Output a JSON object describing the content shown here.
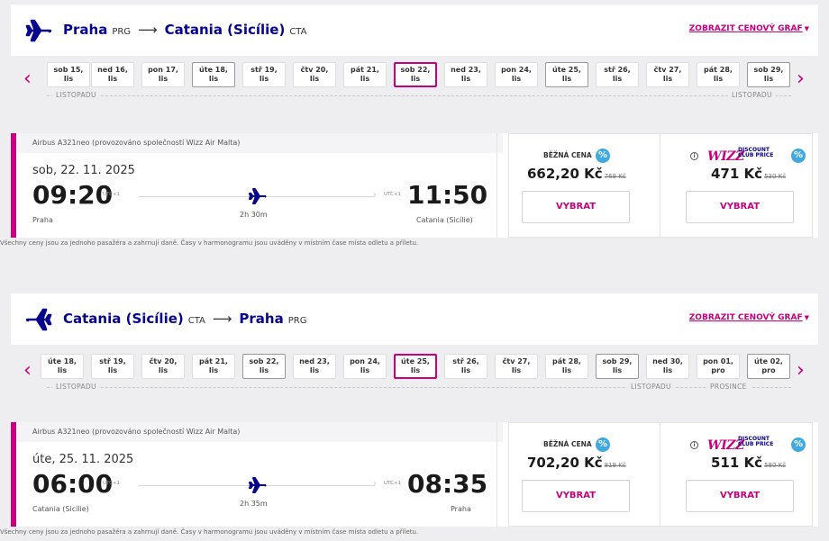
{
  "colors": {
    "brand": "#06038d",
    "accent": "#c6007e",
    "badge": "#3fa9e0"
  },
  "footnote": "Všechny ceny jsou za jednoho pasažéra a zahrnují daně. Časy v harmonogramu jsou uváděny v místním čase místa odletu a příletu.",
  "outbound": {
    "from_city": "Praha",
    "from_code": "PRG",
    "to_city": "Catania (Sicílie)",
    "to_code": "CTA",
    "arrow": "⟶",
    "chart_link": "ZOBRAZIT CENOVÝ GRAF",
    "month_left": "LISTOPADU",
    "month_right": "LISTOPADU",
    "dates": [
      {
        "d": "sob 15,",
        "m": "lis"
      },
      {
        "d": "ned 16,",
        "m": "lis"
      },
      {
        "d": "pon 17,",
        "m": "lis"
      },
      {
        "d": "úte 18,",
        "m": "lis"
      },
      {
        "d": "stř 19,",
        "m": "lis"
      },
      {
        "d": "čtv 20,",
        "m": "lis"
      },
      {
        "d": "pát 21,",
        "m": "lis"
      },
      {
        "d": "sob 22,",
        "m": "lis"
      },
      {
        "d": "ned 23,",
        "m": "lis"
      },
      {
        "d": "pon 24,",
        "m": "lis"
      },
      {
        "d": "úte 25,",
        "m": "lis"
      },
      {
        "d": "stř 26,",
        "m": "lis"
      },
      {
        "d": "čtv 27,",
        "m": "lis"
      },
      {
        "d": "pát 28,",
        "m": "lis"
      },
      {
        "d": "sob 29,",
        "m": "lis"
      }
    ],
    "selected_index": 7,
    "aircraft": "Airbus A321neo (provozováno společností Wizz Air Malta)",
    "date": "sob, 22. 11. 2025",
    "dep_time": "09:20",
    "dep_tz": "UTC+1",
    "arr_time": "11:50",
    "arr_tz": "UTC+1",
    "duration": "2h 30m",
    "dep_city": "Praha",
    "arr_city": "Catania (Sicílie)",
    "regular_label": "BĚŽNÁ CENA",
    "regular_price": "662,20 Kč",
    "regular_old": "769 Kč",
    "club_price": "471 Kč",
    "club_old": "530 Kč",
    "select_label": "VYBRAT"
  },
  "return": {
    "from_city": "Catania (Sicílie)",
    "from_code": "CTA",
    "to_city": "Praha",
    "to_code": "PRG",
    "arrow": "⟶",
    "chart_link": "ZOBRAZIT CENOVÝ GRAF",
    "month_left": "LISTOPADU",
    "month_mid": "LISTOPADU",
    "month_right": "PROSINCE",
    "dates": [
      {
        "d": "úte 18,",
        "m": "lis"
      },
      {
        "d": "stř 19,",
        "m": "lis"
      },
      {
        "d": "čtv 20,",
        "m": "lis"
      },
      {
        "d": "pát 21,",
        "m": "lis"
      },
      {
        "d": "sob 22,",
        "m": "lis"
      },
      {
        "d": "ned 23,",
        "m": "lis"
      },
      {
        "d": "pon 24,",
        "m": "lis"
      },
      {
        "d": "úte 25,",
        "m": "lis"
      },
      {
        "d": "stř 26,",
        "m": "lis"
      },
      {
        "d": "čtv 27,",
        "m": "lis"
      },
      {
        "d": "pát 28,",
        "m": "lis"
      },
      {
        "d": "sob 29,",
        "m": "lis"
      },
      {
        "d": "ned 30,",
        "m": "lis"
      },
      {
        "d": "pon 01,",
        "m": "pro"
      },
      {
        "d": "úte 02,",
        "m": "pro"
      }
    ],
    "selected_index": 7,
    "aircraft": "Airbus A321neo (provozováno společností Wizz Air Malta)",
    "date": "úte, 25. 11. 2025",
    "dep_time": "06:00",
    "dep_tz": "UTC+1",
    "arr_time": "08:35",
    "arr_tz": "UTC+1",
    "duration": "2h 35m",
    "dep_city": "Catania (Sicílie)",
    "arr_city": "Praha",
    "regular_label": "BĚŽNÁ CENA",
    "regular_price": "702,20 Kč",
    "regular_old": "819 Kč",
    "club_price": "511 Kč",
    "club_old": "580 Kč",
    "select_label": "VYBRAT"
  },
  "club_logo": {
    "wizz": "WIZZ",
    "line1": "DISCOUNT",
    "line2": "CLUB PRICE"
  },
  "badge_symbol": "%",
  "info_symbol": "i",
  "nav": {
    "prev": "‹",
    "next": "›"
  }
}
